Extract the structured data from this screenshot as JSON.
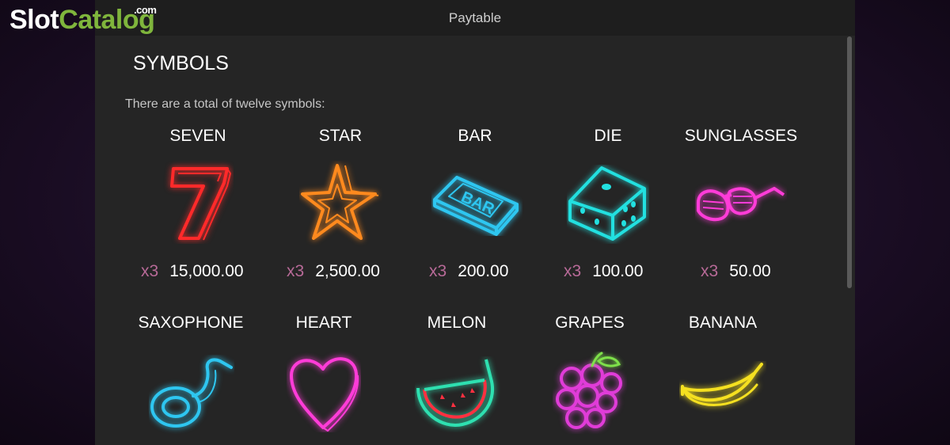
{
  "watermark": {
    "slot": "Slot",
    "catalog": "Catalog",
    "dotcom": ".com"
  },
  "header": {
    "title": "Paytable"
  },
  "section": {
    "title": "SYMBOLS",
    "intro": "There are a total of twelve symbols:"
  },
  "symbols": [
    {
      "name": "SEVEN",
      "icon": "seven-icon",
      "color": "#ff2a2a",
      "multiplier": "x3",
      "payout": "15,000.00"
    },
    {
      "name": "STAR",
      "icon": "star-icon",
      "color": "#ff8a1e",
      "multiplier": "x3",
      "payout": "2,500.00"
    },
    {
      "name": "BAR",
      "icon": "bar-icon",
      "color": "#2ec6f0",
      "multiplier": "x3",
      "payout": "200.00"
    },
    {
      "name": "DIE",
      "icon": "die-icon",
      "color": "#22e0e0",
      "multiplier": "x3",
      "payout": "100.00"
    },
    {
      "name": "SUNGLASSES",
      "icon": "sunglasses-icon",
      "color": "#ff3cd8",
      "multiplier": "x3",
      "payout": "50.00"
    },
    {
      "name": "SAXOPHONE",
      "icon": "saxophone-icon",
      "color": "#2ec6f0"
    },
    {
      "name": "HEART",
      "icon": "heart-icon",
      "color": "#ff3cd8"
    },
    {
      "name": "MELON",
      "icon": "melon-icon",
      "color": "#2ee0b0"
    },
    {
      "name": "GRAPES",
      "icon": "grapes-icon",
      "color": "#e03cd8"
    },
    {
      "name": "BANANA",
      "icon": "banana-icon",
      "color": "#f5e020"
    }
  ]
}
